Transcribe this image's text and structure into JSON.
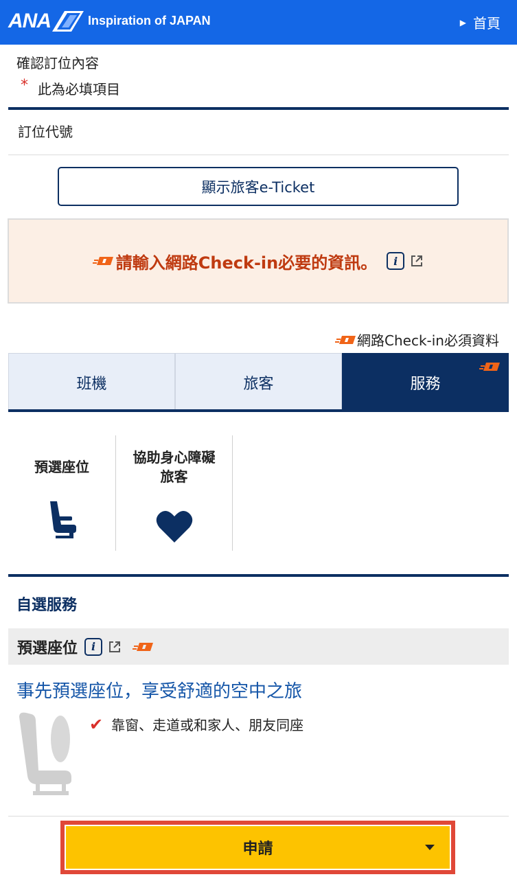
{
  "header": {
    "logo_text": "ANA",
    "tagline": "Inspiration of JAPAN",
    "home_label": "首頁"
  },
  "page": {
    "title": "確認訂位內容",
    "required_star": "*",
    "required_note": "此為必填項目",
    "booking_ref_label": "訂位代號"
  },
  "eticket_button": "顯示旅客e-Ticket",
  "notice": {
    "text": "請輸入網路Check-in必要的資訊。",
    "info_glyph": "i"
  },
  "checkin_legend": "網路Check-in必須資料",
  "tabs": [
    {
      "label": "班機",
      "active": false
    },
    {
      "label": "旅客",
      "active": false
    },
    {
      "label": "服務",
      "active": true
    }
  ],
  "services": [
    {
      "label": "預選座位",
      "icon": "seat-icon"
    },
    {
      "label_line1": "協助身心障礙",
      "label_line2": "旅客",
      "icon": "heart-icon"
    }
  ],
  "optional_services": {
    "title": "自選服務",
    "seat_section_title": "預選座位",
    "promo_title": "事先預選座位，享受舒適的空中之旅",
    "bullets": [
      "靠窗、走道或和家人、朋友同座"
    ]
  },
  "apply_button": "申請",
  "colors": {
    "header_blue": "#1467e6",
    "navy": "#0c2f62",
    "notice_bg": "#fcefe5",
    "notice_text": "#bf3a10",
    "apply_yellow": "#fdc300",
    "highlight_red": "#e04838",
    "checkin_mark_orange": "#f06418"
  }
}
